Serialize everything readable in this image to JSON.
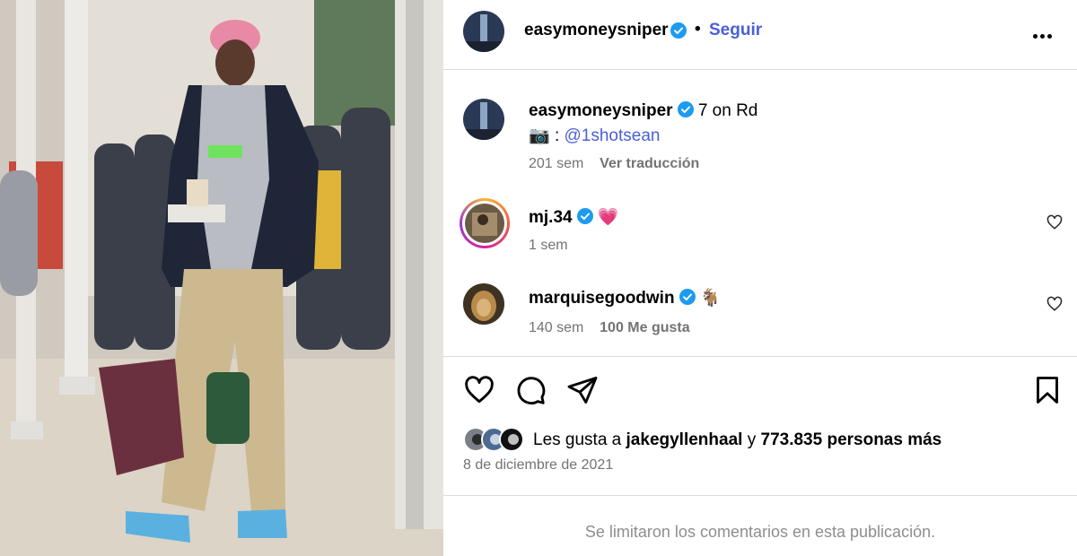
{
  "post": {
    "author": "easymoneysniper",
    "follow_label": "Seguir",
    "separator": "•",
    "more_icon": "more-icon"
  },
  "caption": {
    "username": "easymoneysniper",
    "text": "7 on Rd",
    "camera_emoji": "📷",
    "colon": ":",
    "mention": "@1shotsean",
    "time": "201 sem",
    "translate_label": "Ver traducción"
  },
  "comments": [
    {
      "username": "mj.34",
      "emoji": "💗",
      "time": "1 sem",
      "likes_label": ""
    },
    {
      "username": "marquisegoodwin",
      "emoji": "🐐",
      "time": "140 sem",
      "likes_label": "100 Me gusta"
    }
  ],
  "actions": {
    "like_icon": "heart-icon",
    "comment_icon": "comment-icon",
    "share_icon": "share-icon",
    "save_icon": "bookmark-icon"
  },
  "likes": {
    "prefix": "Les gusta a",
    "user": "jakegyllenhaal",
    "connector": "y",
    "others": "773.835 personas más"
  },
  "date": "8 de diciembre de 2021",
  "comments_limited": "Se limitaron los comentarios en esta publicación.",
  "colors": {
    "link": "#4a5fd6",
    "verified": "#1d9bf0",
    "secondary_text": "#737373",
    "border": "#dbdbdb"
  }
}
